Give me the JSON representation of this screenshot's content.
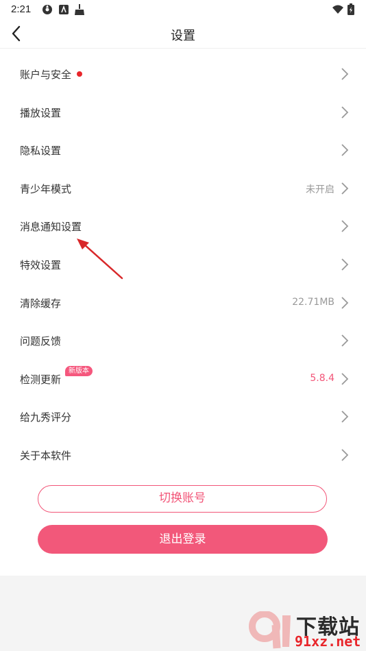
{
  "status_bar": {
    "time": "2:21"
  },
  "header": {
    "title": "设置"
  },
  "settings": [
    {
      "label": "账户与安全",
      "value": ""
    },
    {
      "label": "播放设置",
      "value": ""
    },
    {
      "label": "隐私设置",
      "value": ""
    },
    {
      "label": "青少年模式",
      "value": "未开启"
    },
    {
      "label": "消息通知设置",
      "value": ""
    },
    {
      "label": "特效设置",
      "value": ""
    },
    {
      "label": "清除缓存",
      "value": "22.71MB"
    },
    {
      "label": "问题反馈",
      "value": ""
    },
    {
      "label": "检测更新",
      "value": "5.8.4",
      "badge": "新版本"
    },
    {
      "label": "给九秀评分",
      "value": ""
    },
    {
      "label": "关于本软件",
      "value": ""
    }
  ],
  "actions": {
    "switch_account": "切换账号",
    "logout": "退出登录"
  },
  "watermark": {
    "line1": "下载站",
    "line2": "91xz.net"
  },
  "colors": {
    "accent": "#f25477",
    "notice_dot": "#e8262b"
  }
}
